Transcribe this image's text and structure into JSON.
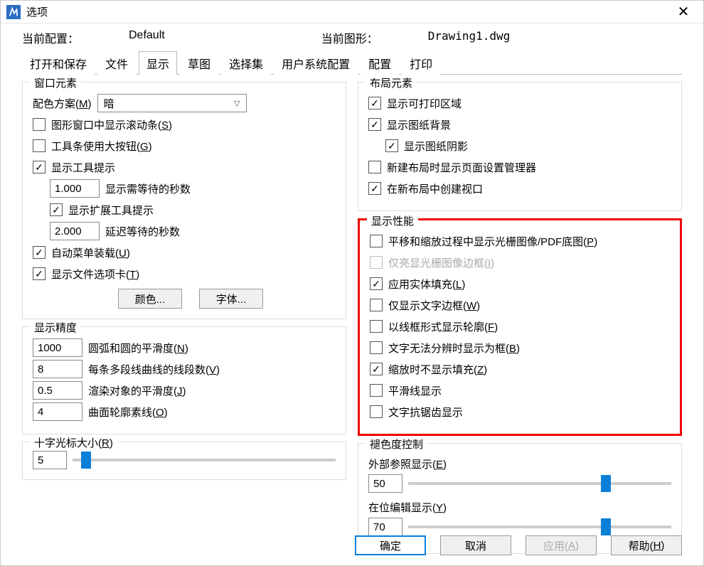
{
  "title": "选项",
  "info": {
    "curConfigLabel": "当前配置：",
    "curConfigValue": "Default",
    "curDrawingLabel": "当前图形：",
    "curDrawingValue": "Drawing1.dwg"
  },
  "tabs": [
    "打开和保存",
    "文件",
    "显示",
    "草图",
    "选择集",
    "用户系统配置",
    "配置",
    "打印"
  ],
  "activeTab": 2,
  "windowElements": {
    "title": "窗口元素",
    "colorSchemeLabel": "配色方案(",
    "colorSchemeKey": "M",
    "colorSchemeEnd": ")",
    "colorSchemeValue": "暗",
    "showScrollbars": "图形窗口中显示滚动条(",
    "showScrollbarsKey": "S",
    "bigButtons": "工具条使用大按钮(",
    "bigButtonsKey": "G",
    "showTooltips": "显示工具提示",
    "tooltipDelayValue": "1.000",
    "tooltipDelayLabel": "显示需等待的秒数",
    "showExtTooltips": "显示扩展工具提示",
    "extDelayValue": "2.000",
    "extDelayLabel": "延迟等待的秒数",
    "autoMenuLoad": "自动菜单装载(",
    "autoMenuLoadKey": "U",
    "showFileTabs": "显示文件选项卡(",
    "showFileTabsKey": "T",
    "colorBtn": "颜色...",
    "fontBtn": "字体..."
  },
  "displayPrecision": {
    "title": "显示精度",
    "arcSmoothValue": "1000",
    "arcSmoothLabel": "圆弧和圆的平滑度(",
    "arcSmoothKey": "N",
    "polylineSegValue": "8",
    "polylineSegLabel": "每条多段线曲线的线段数(",
    "polylineSegKey": "V",
    "renderSmoothValue": "0.5",
    "renderSmoothLabel": "渲染对象的平滑度(",
    "renderSmoothKey": "J",
    "surfaceContourValue": "4",
    "surfaceContourLabel": "曲面轮廓素线(",
    "surfaceContourKey": "O"
  },
  "crosshair": {
    "title": "十字光标大小(",
    "titleKey": "R",
    "value": "5",
    "percent": 5
  },
  "layoutElements": {
    "title": "布局元素",
    "showPrintable": "显示可打印区域",
    "showPaperBg": "显示图纸背景",
    "showPaperShadow": "显示图纸阴影",
    "pageSetupOnNew": "新建布局时显示页面设置管理器",
    "createViewportNew": "在新布局中创建视口"
  },
  "displayPerf": {
    "title": "显示性能",
    "panZoomRaster": "平移和缩放过程中显示光栅图像/PDF底图(",
    "panZoomRasterKey": "P",
    "highlightRaster": "仅亮显光栅图像边框(",
    "highlightRasterKey": "I",
    "solidFill": "应用实体填充(",
    "solidFillKey": "L",
    "textBoundary": "仅显示文字边框(",
    "textBoundaryKey": "W",
    "wireframe": "以线框形式显示轮廓(",
    "wireframeKey": "F",
    "textBox": "文字无法分辨时显示为框(",
    "textBoxKey": "B",
    "noFillZoom": "缩放时不显示填充(",
    "noFillZoomKey": "Z",
    "smoothLine": "平滑线显示",
    "textAntialias": "文字抗锯齿显示"
  },
  "fadeControl": {
    "title": "褪色度控制",
    "xrefLabel": "外部参照显示(",
    "xrefKey": "E",
    "xrefValue": "50",
    "xrefPercent": 75,
    "inplaceLabel": "在位编辑显示(",
    "inplaceKey": "Y",
    "inplaceValue": "70",
    "inplacePercent": 75
  },
  "footer": {
    "ok": "确定",
    "cancel": "取消",
    "apply": "应用(",
    "applyKey": "A",
    "help": "帮助(",
    "helpKey": "H"
  }
}
